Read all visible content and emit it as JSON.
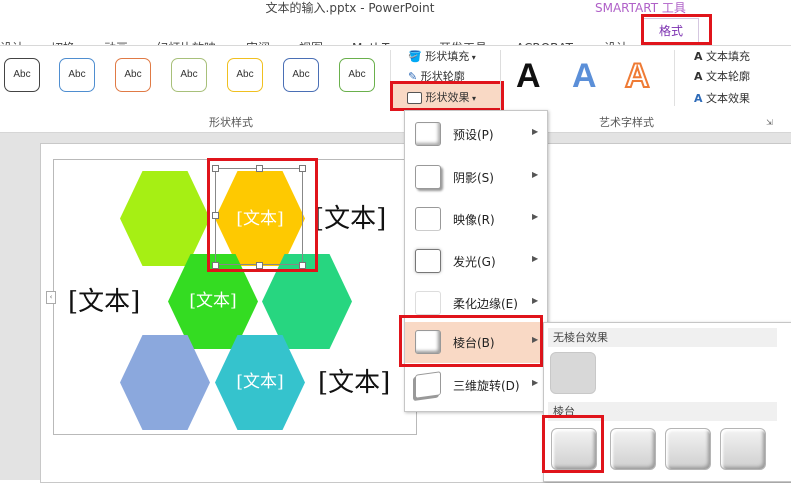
{
  "window": {
    "title": "文本的输入.pptx - PowerPoint",
    "context_tools": "SMARTART 工具"
  },
  "tabs": {
    "design_partial": "设计",
    "transitions": "切换",
    "animations": "动画",
    "slideshow": "幻灯片放映",
    "review": "审阅",
    "view": "视图",
    "mathtype": "MathType",
    "developer": "开发工具",
    "acrobat": "ACROBAT",
    "smartart_design": "设计",
    "format": "格式"
  },
  "ribbon": {
    "shape_styles": {
      "label": "形状样式",
      "swatch_text": "Abc",
      "swatch_colors": [
        "#444444",
        "#4f8ed0",
        "#e07a45",
        "#a8c07a",
        "#f0c020",
        "#4a6fb5",
        "#6ab04c"
      ],
      "shape_fill": "形状填充",
      "shape_outline": "形状轮廓",
      "shape_effects": "形状效果"
    },
    "wordart_styles": {
      "label": "艺术字样式",
      "sample_letter": "A",
      "text_fill": "文本填充",
      "text_outline": "文本轮廓",
      "text_effects": "文本效果"
    }
  },
  "slide": {
    "placeholder_top": "[文本]",
    "placeholder_left": "[文本]",
    "placeholder_bottom": "[文本]",
    "hex_text_selected": "[文本]",
    "hex_text_green": "[文本]",
    "hex_text_teal": "[文本]",
    "colors": {
      "lime": "#a6ef14",
      "gold": "#fec901",
      "green": "#34dc22",
      "jade": "#27d680",
      "periwinkle": "#8ba8dd",
      "teal": "#35c3cd"
    }
  },
  "effects_menu": {
    "items": [
      {
        "label": "预设(P)"
      },
      {
        "label": "阴影(S)"
      },
      {
        "label": "映像(R)"
      },
      {
        "label": "发光(G)"
      },
      {
        "label": "柔化边缘(E)"
      },
      {
        "label": "棱台(B)"
      },
      {
        "label": "三维旋转(D)"
      }
    ]
  },
  "bevel_submenu": {
    "no_bevel_header": "无棱台效果",
    "bevel_header": "棱台"
  },
  "accent_colors": {
    "highlight_box": "#e0141b",
    "menu_hover": "#f9d9c5",
    "format_tab_text": "#7b2fb0"
  }
}
